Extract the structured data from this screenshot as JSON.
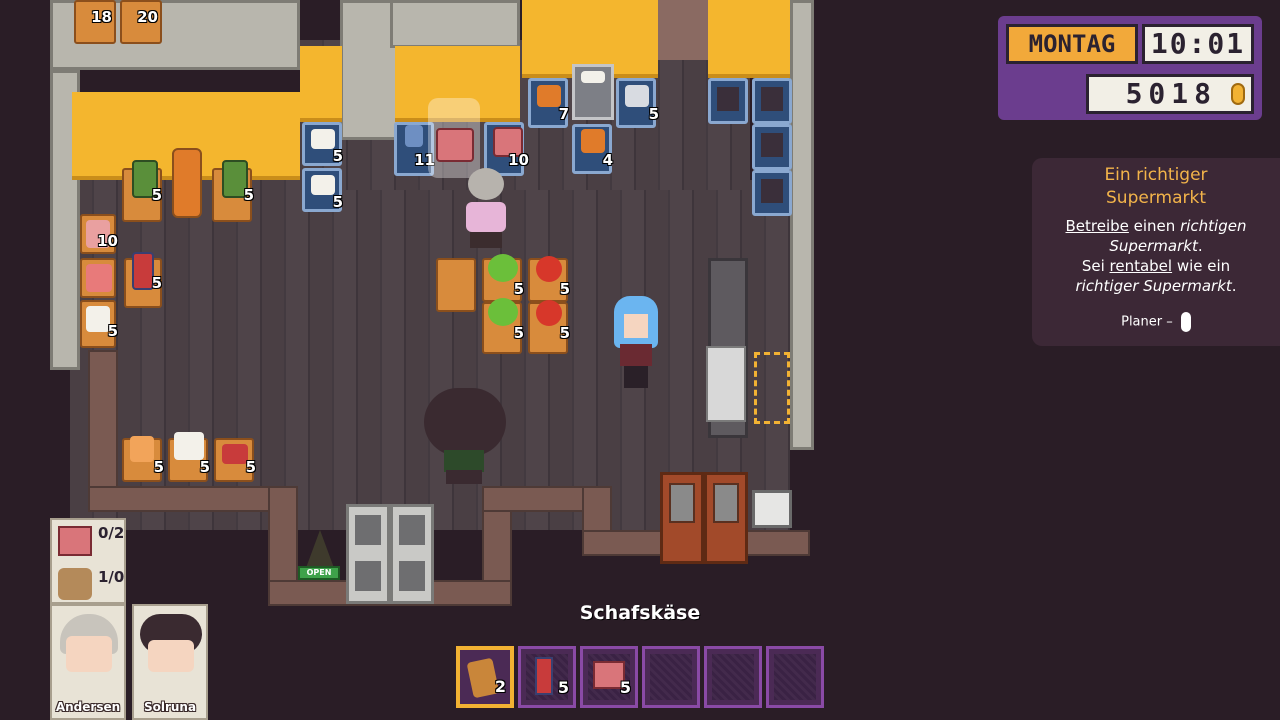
{
  "hud": {
    "day": "MONTAG",
    "time": "10:01",
    "money": "5018",
    "coin_icon": "coin-icon"
  },
  "quest": {
    "title": "Ein richtiger Supermarkt",
    "line1_a": "Betreibe",
    "line1_b": " einen ",
    "line1_c": "richtigen",
    "line2": "Supermarkt",
    "line2_end": ".",
    "line3_a": "Sei ",
    "line3_b": "rentabel",
    "line3_c": " wie ein",
    "line4": "richtiger Supermarkt",
    "line4_end": ".",
    "planner_label": "Planer –",
    "planner_icon": "mouse-icon"
  },
  "shelves": {
    "top_left": [
      "18",
      "20"
    ],
    "left_col": [
      "5",
      "5",
      "5"
    ],
    "left_upper": [
      "10",
      "5",
      "5"
    ],
    "left_bottom": [
      "5",
      "5",
      "5"
    ],
    "fridges_mid": [
      "5",
      "5"
    ],
    "fridges_center": [
      "11",
      "10"
    ],
    "fridges_right": [
      "7",
      "5",
      "4"
    ],
    "produce": [
      "5",
      "5",
      "5",
      "5"
    ]
  },
  "store": {
    "open_sign": "OPEN"
  },
  "tasks": [
    {
      "icon": "meat-icon",
      "progress": "0/2"
    },
    {
      "icon": "cheese-icon",
      "progress": "1/0"
    }
  ],
  "characters": [
    {
      "name": "Andersen"
    },
    {
      "name": "Solruna"
    }
  ],
  "hotbar": {
    "hover_label": "Schafskäse",
    "slots": [
      {
        "icon": "cheese-icon",
        "count": "2",
        "selected": true
      },
      {
        "icon": "cleaner-icon",
        "count": "5"
      },
      {
        "icon": "meat-icon",
        "count": "5"
      },
      {
        "icon": "empty-slot",
        "count": ""
      },
      {
        "icon": "empty-slot",
        "count": ""
      },
      {
        "icon": "empty-slot",
        "count": ""
      }
    ]
  }
}
